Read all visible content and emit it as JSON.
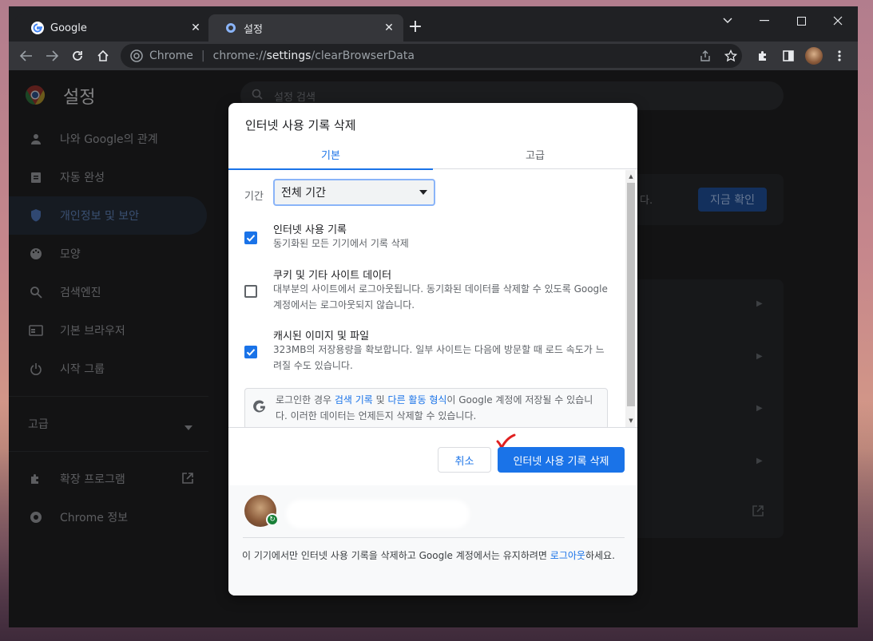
{
  "tabs": [
    {
      "title": "Google",
      "icon": "google-icon"
    },
    {
      "title": "설정",
      "icon": "settings-gear-icon"
    }
  ],
  "omnibox": {
    "chip_label": "Chrome",
    "url_prefix": "chrome://",
    "url_bold": "settings",
    "url_suffix": "/clearBrowserData"
  },
  "settings": {
    "title": "설정",
    "search_placeholder": "설정 검색",
    "sidebar": [
      {
        "label": "나와 Google의 관계",
        "icon": "person-icon"
      },
      {
        "label": "자동 완성",
        "icon": "clipboard-icon"
      },
      {
        "label": "개인정보 및 보안",
        "icon": "shield-icon",
        "selected": true
      },
      {
        "label": "모양",
        "icon": "palette-icon"
      },
      {
        "label": "검색엔진",
        "icon": "search-icon"
      },
      {
        "label": "기본 브라우저",
        "icon": "browser-icon"
      },
      {
        "label": "시작 그룹",
        "icon": "power-icon"
      }
    ],
    "advanced": "고급",
    "extensions": "확장 프로그램",
    "about": "Chrome 정보",
    "bg_button": "지금 확인",
    "bg_card_text": "다."
  },
  "dialog": {
    "title": "인터넷 사용 기록 삭제",
    "tab_basic": "기본",
    "tab_advanced": "고급",
    "range_label": "기간",
    "range_value": "전체 기간",
    "options": [
      {
        "title": "인터넷 사용 기록",
        "desc": "동기화된 모든 기기에서 기록 삭제",
        "checked": true
      },
      {
        "title": "쿠키 및 기타 사이트 데이터",
        "desc": "대부분의 사이트에서 로그아웃됩니다. 동기화된 데이터를 삭제할 수 있도록 Google 계정에서는 로그아웃되지 않습니다.",
        "checked": false
      },
      {
        "title": "캐시된 이미지 및 파일",
        "desc": "323MB의 저장용량을 확보합니다. 일부 사이트는 다음에 방문할 때 로드 속도가 느려질 수도 있습니다.",
        "checked": true
      }
    ],
    "google_note": {
      "pre": "로그인한 경우 ",
      "link1": "검색 기록",
      "mid": " 및 ",
      "link2": "다른 활동 형식",
      "post": "이 Google 계정에 저장될 수 있습니다. 이러한 데이터는 언제든지 삭제할 수 있습니다."
    },
    "cancel": "취소",
    "confirm": "인터넷 사용 기록 삭제",
    "footer": {
      "pre": "이 기기에서만 인터넷 사용 기록을 삭제하고 Google 계정에서는 유지하려면 ",
      "link": "로그아웃",
      "post": "하세요."
    }
  },
  "colors": {
    "accent": "#1a73e8",
    "checkbox_checked": "#1a73e8"
  }
}
